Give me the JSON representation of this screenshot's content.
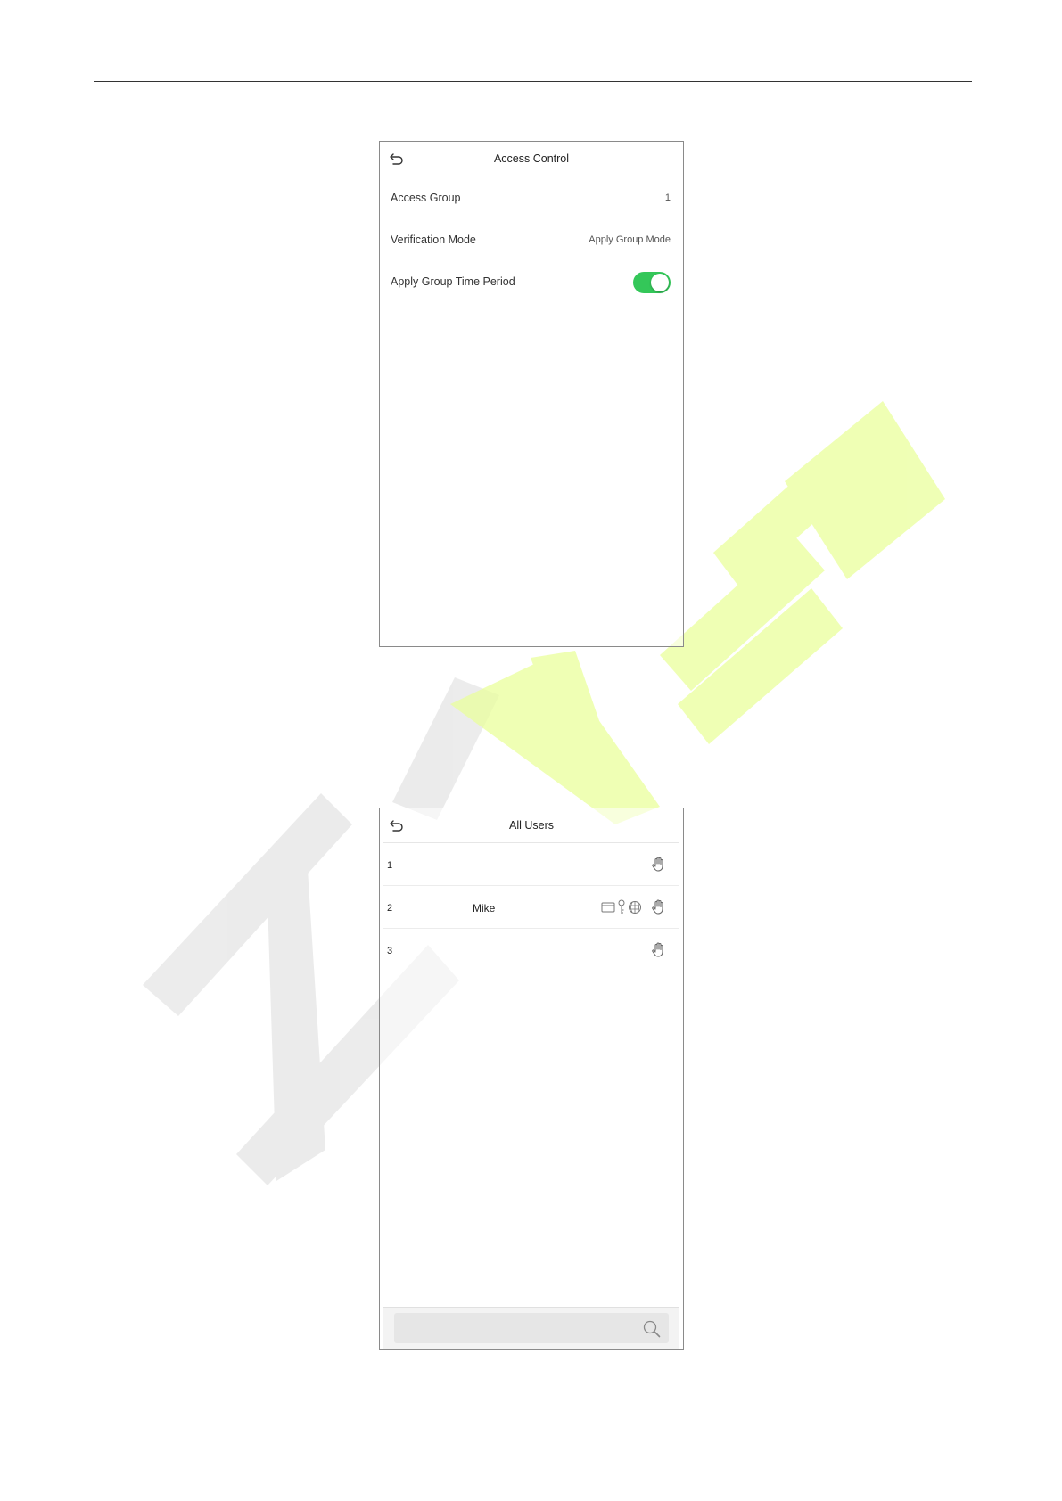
{
  "screens": {
    "access_control": {
      "title": "Access Control",
      "rows": [
        {
          "label": "Access Group",
          "value": "1"
        },
        {
          "label": "Verification Mode",
          "value": "Apply Group Mode"
        },
        {
          "label": "Apply Group Time Period",
          "toggle_on": true
        }
      ]
    },
    "all_users": {
      "title": "All Users",
      "users": [
        {
          "id": "1",
          "name": "",
          "credentials": [],
          "palm": true
        },
        {
          "id": "2",
          "name": "Mike",
          "credentials": [
            "card-icon",
            "password-key-icon",
            "face-icon"
          ],
          "palm": true
        },
        {
          "id": "3",
          "name": "",
          "credentials": [],
          "palm": true
        }
      ],
      "search": {
        "placeholder": "",
        "value": ""
      }
    }
  },
  "icons": {
    "back": "back-arrow-icon",
    "palm": "palm-icon",
    "search": "search-icon"
  },
  "colors": {
    "toggle_on": "#34c759",
    "watermark_green": "#eaff9c",
    "watermark_gray": "#dcdcdc"
  }
}
